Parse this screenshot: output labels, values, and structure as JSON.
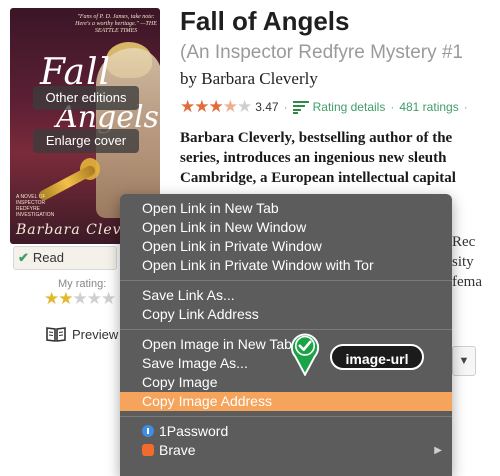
{
  "cover": {
    "title_script_1": "Fall",
    "title_script_2": "Angels",
    "author_script": "Barbara Clev",
    "blurb": "\"Fans of P. D. James, take note: Here's a worthy heritage.\" —THE SEATTLE TIMES",
    "series_note": "A NOVEL OF INSPECTOR REDFYRE INVESTIGATION",
    "other_editions_label": "Other editions",
    "enlarge_cover_label": "Enlarge cover"
  },
  "shelf": {
    "read_label": "Read",
    "my_rating_label": "My rating:",
    "my_rating_stars": 2,
    "preview_label": "Preview"
  },
  "book": {
    "title": "Fall of Angels",
    "series": "(An Inspector Redfyre Mystery #1",
    "byline": "by Barbara Cleverly",
    "avg_rating": "3.47",
    "rating_details_label": "Rating details",
    "ratings_count": "481 ratings",
    "description_lines": [
      "Barbara Cleverly, bestselling author of the",
      "series, introduces an ingenious new sleuth",
      "Cambridge, a European intellectual capital"
    ],
    "desc_fragments": [
      "Rec",
      "sity",
      "fema"
    ]
  },
  "context_menu": {
    "items": [
      "Open Link in New Tab",
      "Open Link in New Window",
      "Open Link in Private Window",
      "Open Link in Private Window with Tor",
      "Save Link As...",
      "Copy Link Address",
      "Open Image in New Tab",
      "Save Image As...",
      "Copy Image",
      "Copy Image Address",
      "1Password",
      "Brave"
    ],
    "highlighted": "Copy Image Address"
  },
  "annotation": {
    "label": "image-url",
    "pin_color": "#1aa347"
  },
  "colors": {
    "highlight": "#f6a35b",
    "menu_bg": "#5c5c5c",
    "link_green": "#409d69",
    "rating_star": "#e06c3a",
    "my_star": "#e1b92c"
  }
}
